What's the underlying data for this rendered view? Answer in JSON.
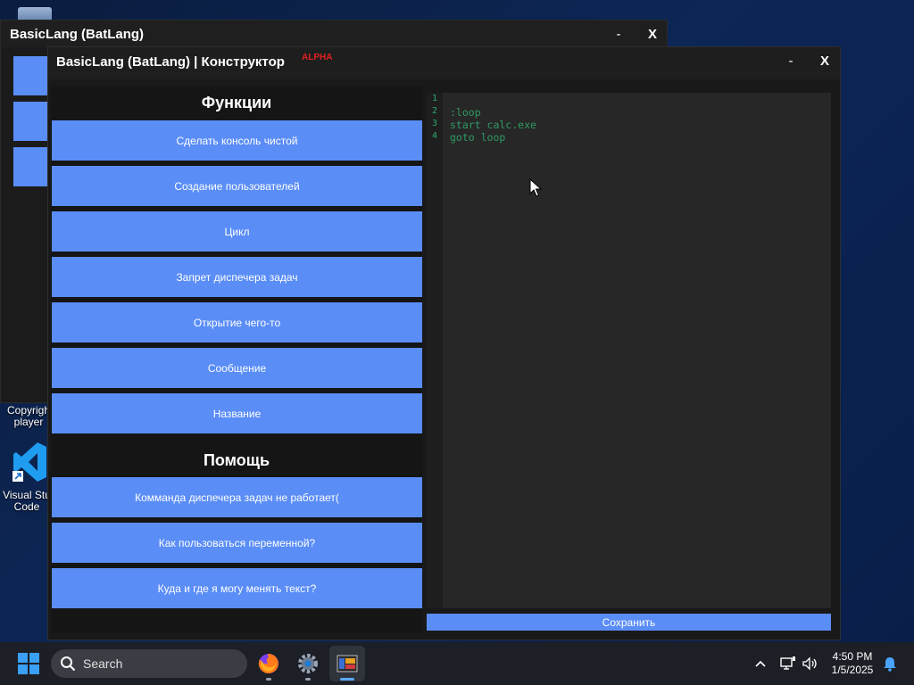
{
  "desktop": {
    "icon_copyright_label": "Copyrigh\nplayer",
    "icon_vscode_label": "Visual Stu\nCode"
  },
  "back_window": {
    "title": "BasicLang (BatLang)",
    "minimize": "-",
    "close": "X"
  },
  "front_window": {
    "title": "BasicLang (BatLang) | Конструктор",
    "badge": "ALPHA",
    "minimize": "-",
    "close": "X"
  },
  "functions": {
    "heading": "Функции",
    "buttons": [
      "Сделать консоль чистой",
      "Создание пользователей",
      "Цикл",
      "Запрет диспечера задач",
      "Открытие чего-то",
      "Сообщение",
      "Название"
    ]
  },
  "help": {
    "heading": "Помощь",
    "buttons": [
      "Комманда диспечера задач не работает(",
      "Как пользоваться переменной?",
      "Куда и где я могу менять текст?"
    ]
  },
  "editor": {
    "line_numbers": [
      "1",
      "2",
      "3",
      "4"
    ],
    "lines": [
      "",
      ":loop",
      "start calc.exe",
      "goto loop"
    ]
  },
  "save_button": "Сохранить",
  "taskbar": {
    "search_placeholder": "Search",
    "apps": [
      "firefox-icon",
      "settings-icon",
      "batlang-app-icon"
    ],
    "time": "4:50 PM",
    "date": "1/5/2025"
  },
  "colors": {
    "accent": "#5a8df6",
    "code": "#2f9a63",
    "alpha": "#e02020"
  }
}
